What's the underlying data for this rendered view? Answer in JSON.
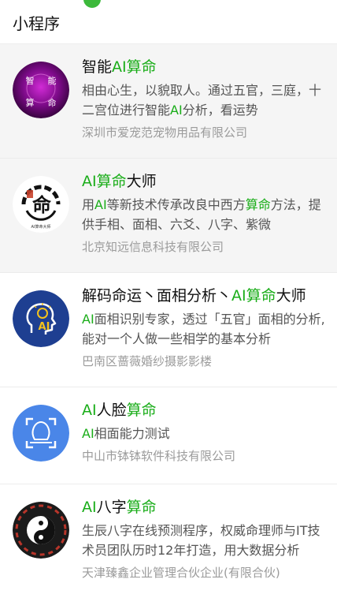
{
  "header": {
    "title": "小程序"
  },
  "accent_color": "#1aad19",
  "items": [
    {
      "name": [
        {
          "t": "智能"
        },
        {
          "t": "AI算命",
          "hl": true
        }
      ],
      "desc": [
        {
          "t": "相由心生，以貌取人。通过五官，三庭，十二宫位进行智能"
        },
        {
          "t": "AI",
          "hl": true
        },
        {
          "t": "分析，看运势"
        }
      ],
      "company": "深圳市爱宠范宠物用品有限公司",
      "logo": {
        "icon": "purple-face-icon",
        "text": [
          "智",
          "能",
          "算",
          "命"
        ]
      }
    },
    {
      "name": [
        {
          "t": "AI算命",
          "hl": true
        },
        {
          "t": "大师"
        }
      ],
      "desc": [
        {
          "t": "用"
        },
        {
          "t": "AI",
          "hl": true
        },
        {
          "t": "等新技术传承改良中西方"
        },
        {
          "t": "算命",
          "hl": true
        },
        {
          "t": "方法，提供手相、面相、六爻、八字、紫微"
        }
      ],
      "company": "北京知远信息科技有限公司",
      "logo": {
        "icon": "calligraphy-ming-icon",
        "text": [
          "命",
          "AI算命大师"
        ]
      }
    },
    {
      "name": [
        {
          "t": "解码命运丶面相分析丶"
        },
        {
          "t": "AI算命",
          "hl": true
        },
        {
          "t": "大师"
        }
      ],
      "desc": [
        {
          "t": "AI",
          "hl": true
        },
        {
          "t": "面相识别专家，透过「五官」面相的分析,能对一个人做一些相学的基本分析"
        }
      ],
      "company": "巴南区蔷薇婚纱摄影影楼",
      "logo": {
        "icon": "head-lightbulb-icon",
        "text": [
          "AI"
        ]
      }
    },
    {
      "name": [
        {
          "t": "AI",
          "hl": true
        },
        {
          "t": "人脸"
        },
        {
          "t": "算命",
          "hl": true
        }
      ],
      "desc": [
        {
          "t": "AI",
          "hl": true
        },
        {
          "t": "相面能力测试"
        }
      ],
      "company": "中山市钵钵软件科技有限公司",
      "logo": {
        "icon": "face-scan-icon",
        "text": []
      }
    },
    {
      "name": [
        {
          "t": "AI",
          "hl": true
        },
        {
          "t": "八字"
        },
        {
          "t": "算命",
          "hl": true
        }
      ],
      "desc": [
        {
          "t": "生辰八字在线预测程序，权威命理师与IT技术员团队历时12年打造，用大数据分析"
        }
      ],
      "company": "天津臻鑫企业管理合伙企业(有限合伙)",
      "logo": {
        "icon": "yin-yang-bagua-icon",
        "text": []
      }
    }
  ]
}
